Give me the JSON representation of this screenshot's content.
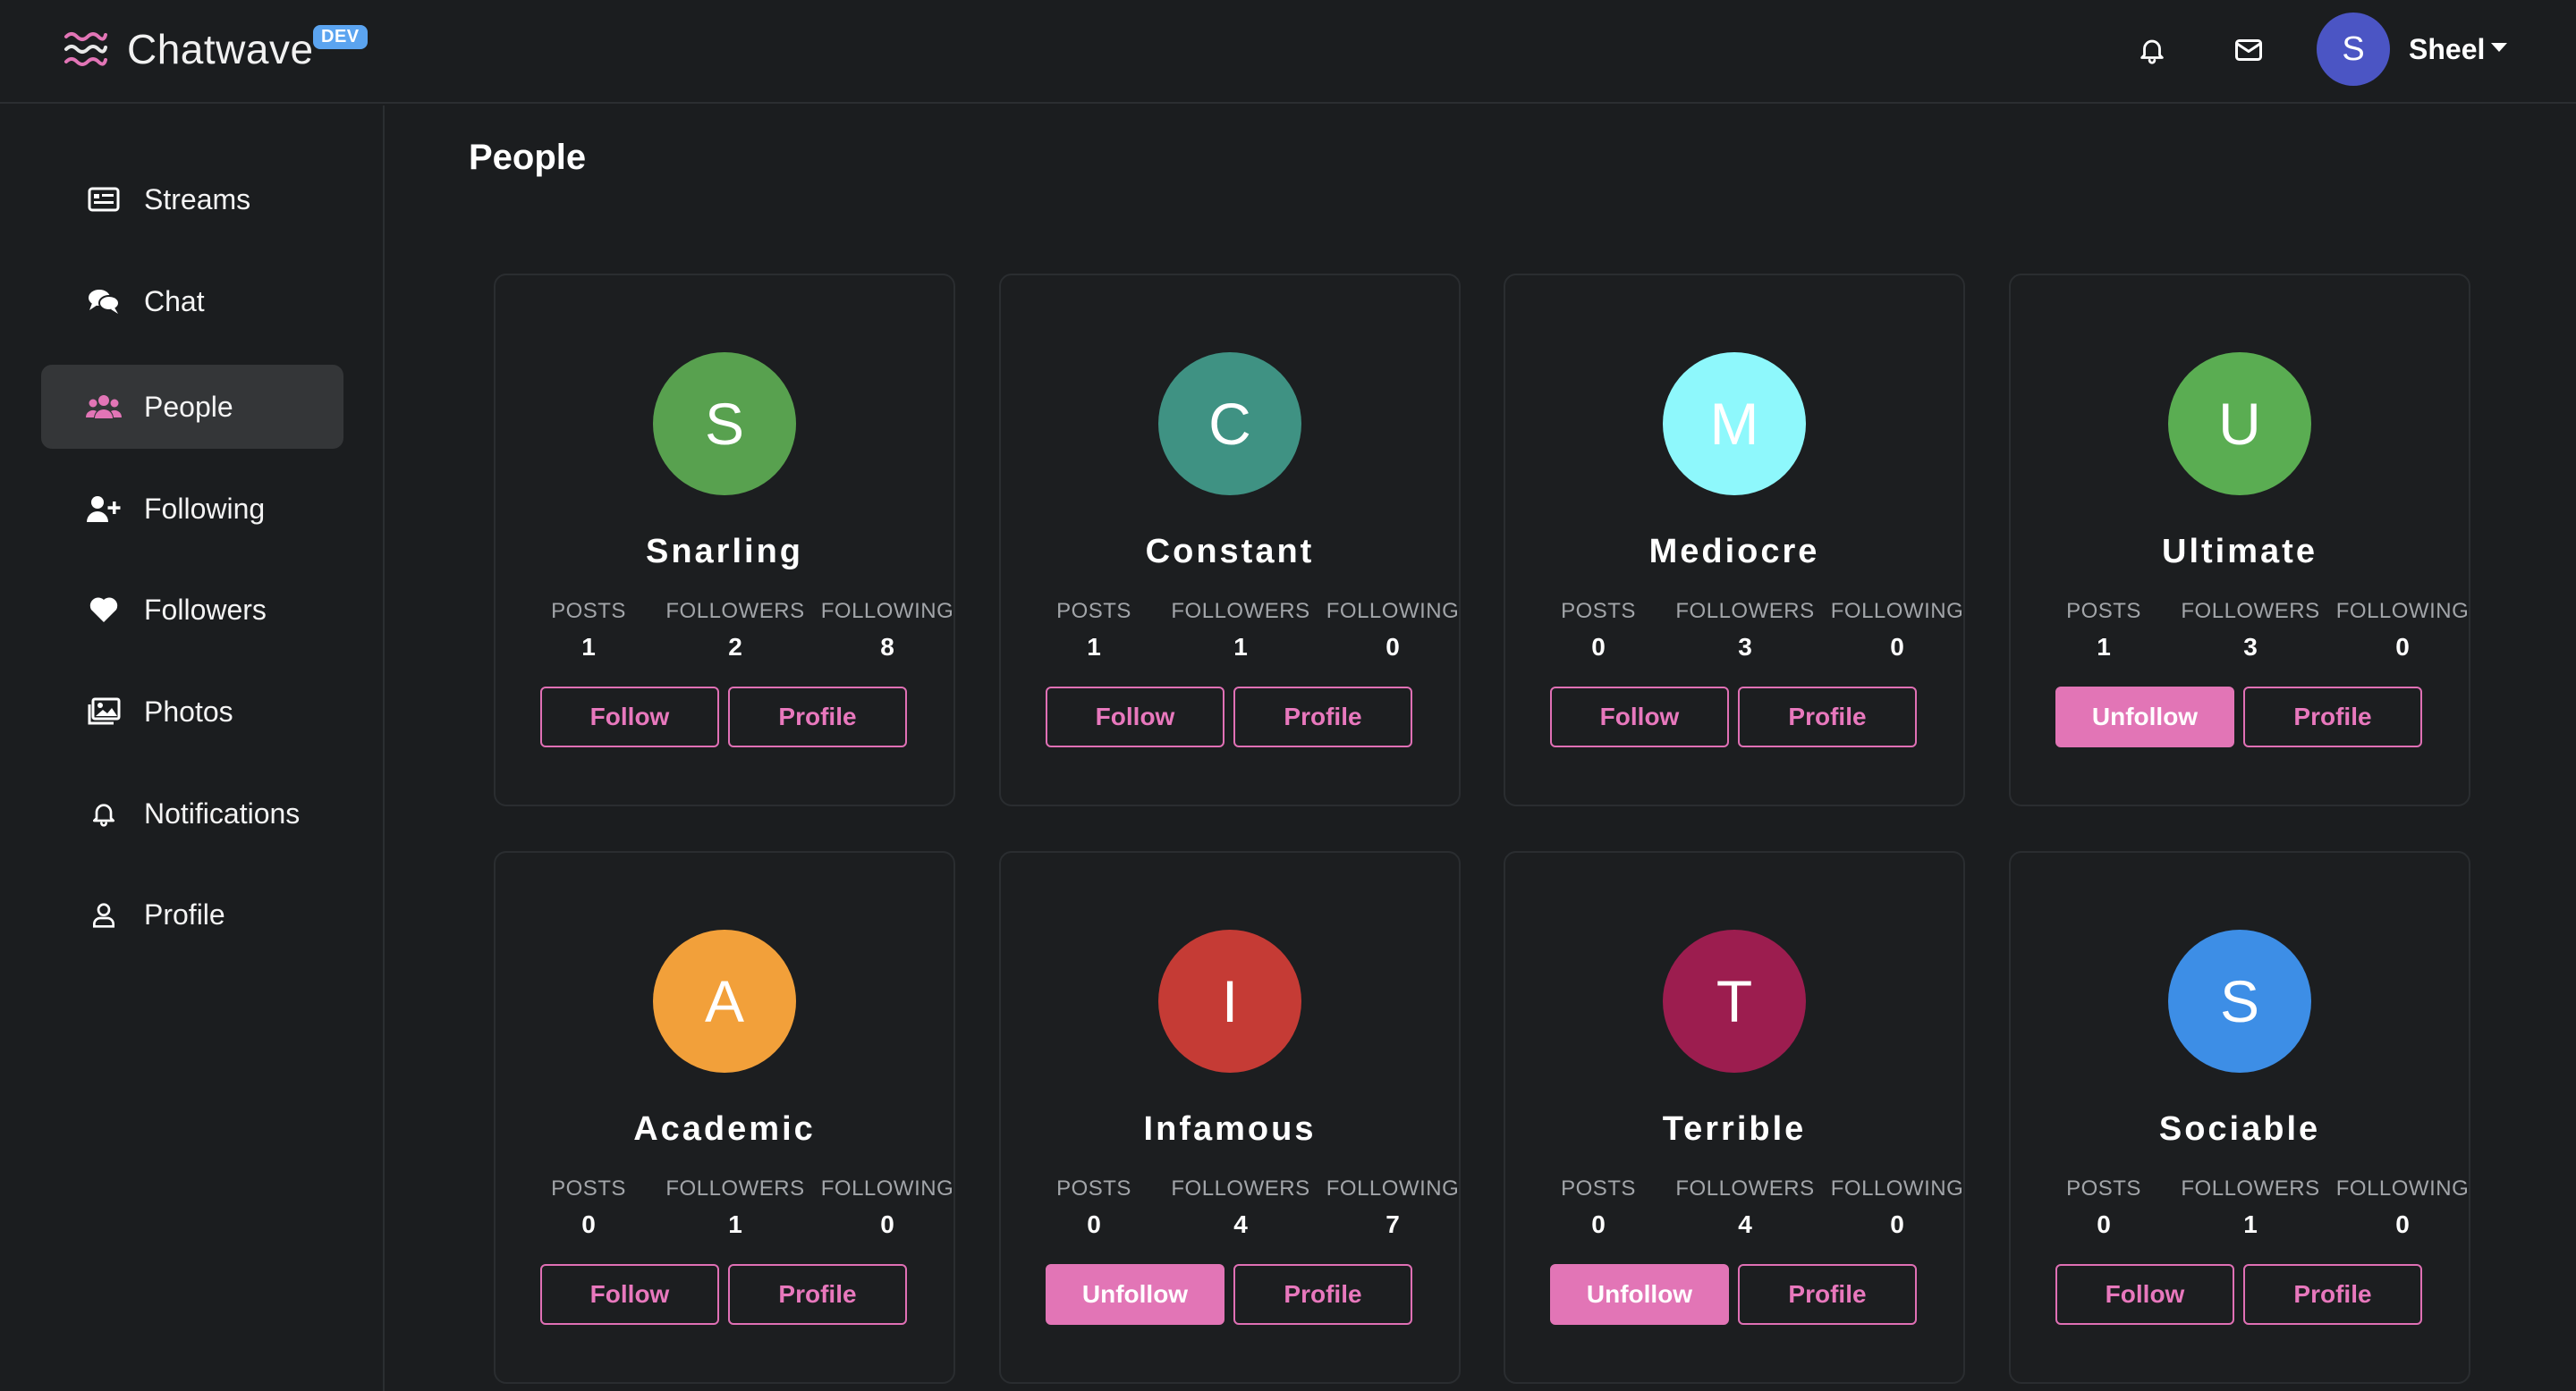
{
  "app": {
    "name": "Chatwave",
    "badge": "DEV"
  },
  "header": {
    "user": {
      "initial": "S",
      "name": "Sheel"
    },
    "icons": [
      "bell-icon",
      "mail-icon"
    ]
  },
  "sidebar": {
    "items": [
      {
        "label": "Streams",
        "icon": "newspaper-icon",
        "active": false
      },
      {
        "label": "Chat",
        "icon": "chat-bubbles-icon",
        "active": false
      },
      {
        "label": "People",
        "icon": "users-icon",
        "active": true
      },
      {
        "label": "Following",
        "icon": "user-plus-icon",
        "active": false
      },
      {
        "label": "Followers",
        "icon": "heart-icon",
        "active": false
      },
      {
        "label": "Photos",
        "icon": "images-icon",
        "active": false
      },
      {
        "label": "Notifications",
        "icon": "bell-icon",
        "active": false
      },
      {
        "label": "Profile",
        "icon": "user-icon",
        "active": false
      }
    ]
  },
  "main": {
    "title": "People",
    "stat_labels": {
      "posts": "POSTS",
      "followers": "FOLLOWERS",
      "following": "FOLLOWING"
    },
    "people": [
      {
        "initial": "S",
        "name": "Snarling",
        "color": "#58a14f",
        "posts": "1",
        "followers": "2",
        "following": "8",
        "action": "Follow",
        "following_state": false,
        "profile": "Profile"
      },
      {
        "initial": "C",
        "name": "Constant",
        "color": "#3f9283",
        "posts": "1",
        "followers": "1",
        "following": "0",
        "action": "Follow",
        "following_state": false,
        "profile": "Profile"
      },
      {
        "initial": "M",
        "name": "Mediocre",
        "color": "#8ef8fc",
        "posts": "0",
        "followers": "3",
        "following": "0",
        "action": "Follow",
        "following_state": false,
        "profile": "Profile"
      },
      {
        "initial": "U",
        "name": "Ultimate",
        "color": "#5aad52",
        "posts": "1",
        "followers": "3",
        "following": "0",
        "action": "Unfollow",
        "following_state": true,
        "profile": "Profile"
      },
      {
        "initial": "A",
        "name": "Academic",
        "color": "#f2a03a",
        "posts": "0",
        "followers": "1",
        "following": "0",
        "action": "Follow",
        "following_state": false,
        "profile": "Profile"
      },
      {
        "initial": "I",
        "name": "Infamous",
        "color": "#c53b35",
        "posts": "0",
        "followers": "4",
        "following": "7",
        "action": "Unfollow",
        "following_state": true,
        "profile": "Profile"
      },
      {
        "initial": "T",
        "name": "Terrible",
        "color": "#9c1d4f",
        "posts": "0",
        "followers": "4",
        "following": "0",
        "action": "Unfollow",
        "following_state": true,
        "profile": "Profile"
      },
      {
        "initial": "S",
        "name": "Sociable",
        "color": "#3d8ee6",
        "posts": "0",
        "followers": "1",
        "following": "0",
        "action": "Follow",
        "following_state": false,
        "profile": "Profile"
      }
    ]
  },
  "colors": {
    "accent": "#e275b6",
    "background": "#1b1d1f",
    "active_nav": "#343638"
  }
}
